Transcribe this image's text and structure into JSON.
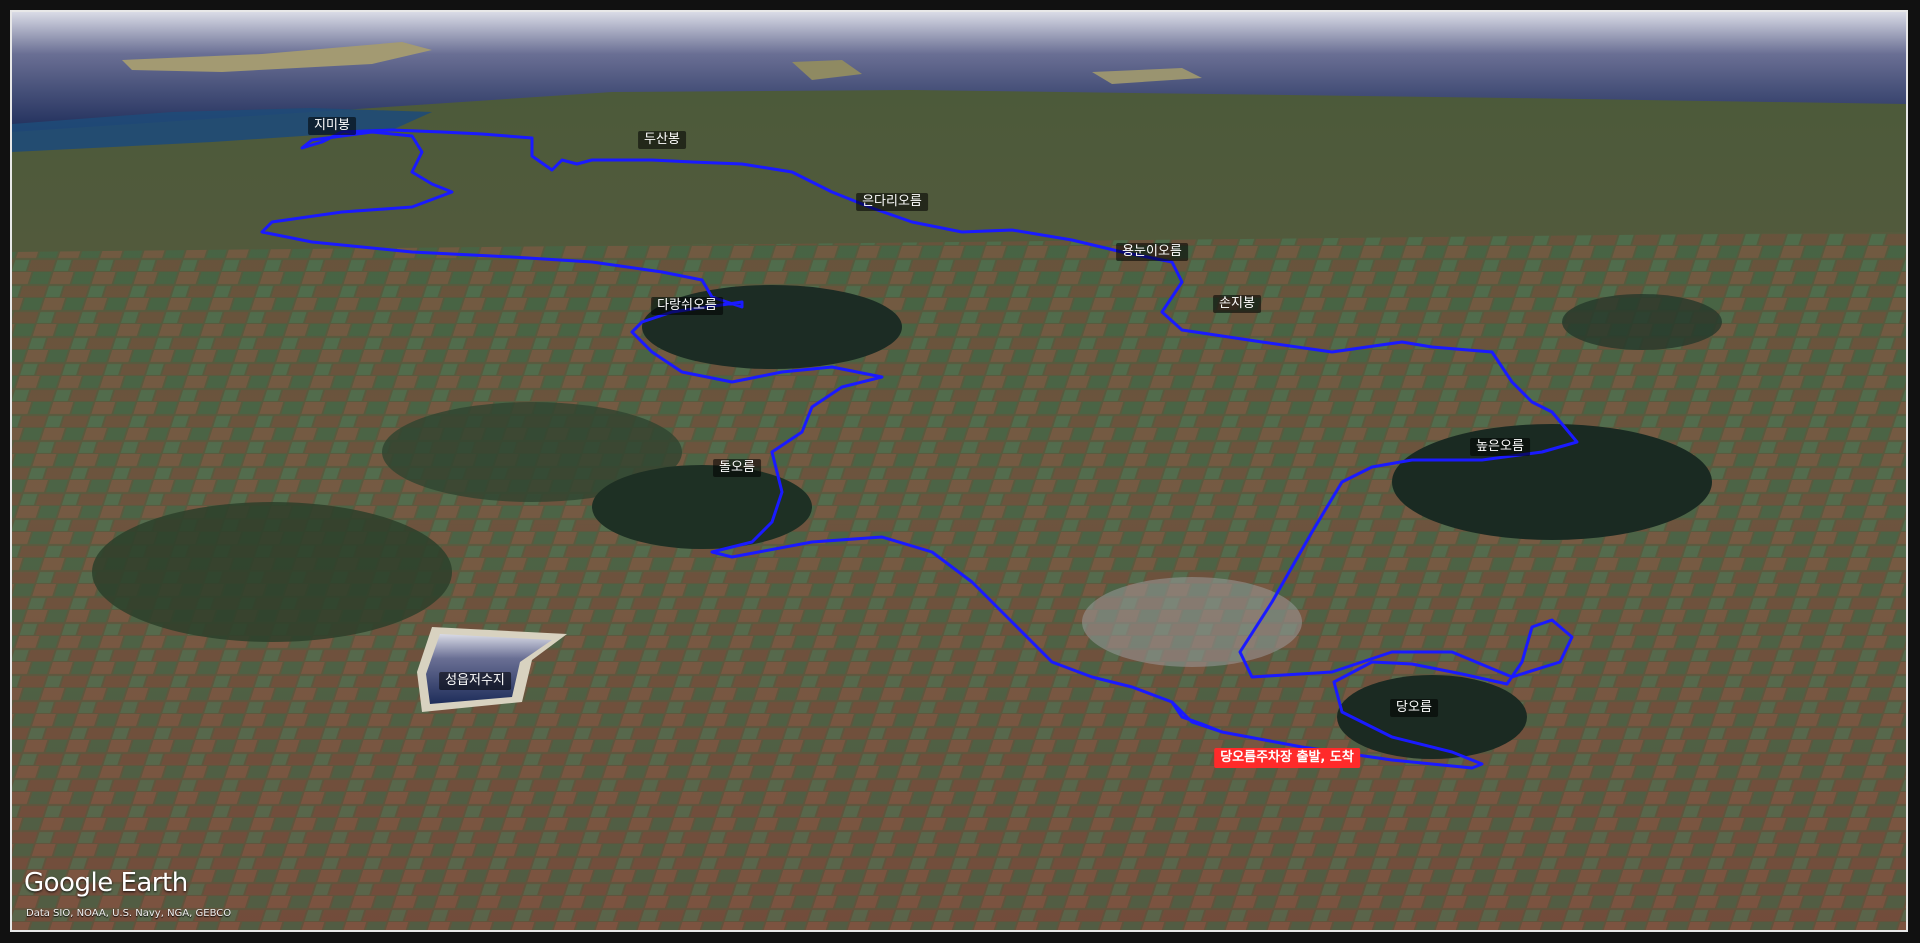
{
  "map": {
    "logo_text": "Google Earth",
    "attribution": "Data SIO, NOAA, U.S. Navy, NGA, GEBCO",
    "labels": {
      "jimibong": "지미봉",
      "dusanbong": "두산봉",
      "eundari": "은다리오름",
      "yongnuni": "용눈이오름",
      "sonjibong": "손지봉",
      "darangswi": "다랑쉬오름",
      "dol": "돌오름",
      "nopeun": "높은오름",
      "dang": "당오름",
      "reservoir": "성읍저수지",
      "start": "당오름주차장 출발, 도착"
    },
    "colors": {
      "route": "#1a1aff",
      "start_badge": "#ff2a2a",
      "water": "#1d3b6e",
      "terrain": "#5b5a45"
    }
  }
}
